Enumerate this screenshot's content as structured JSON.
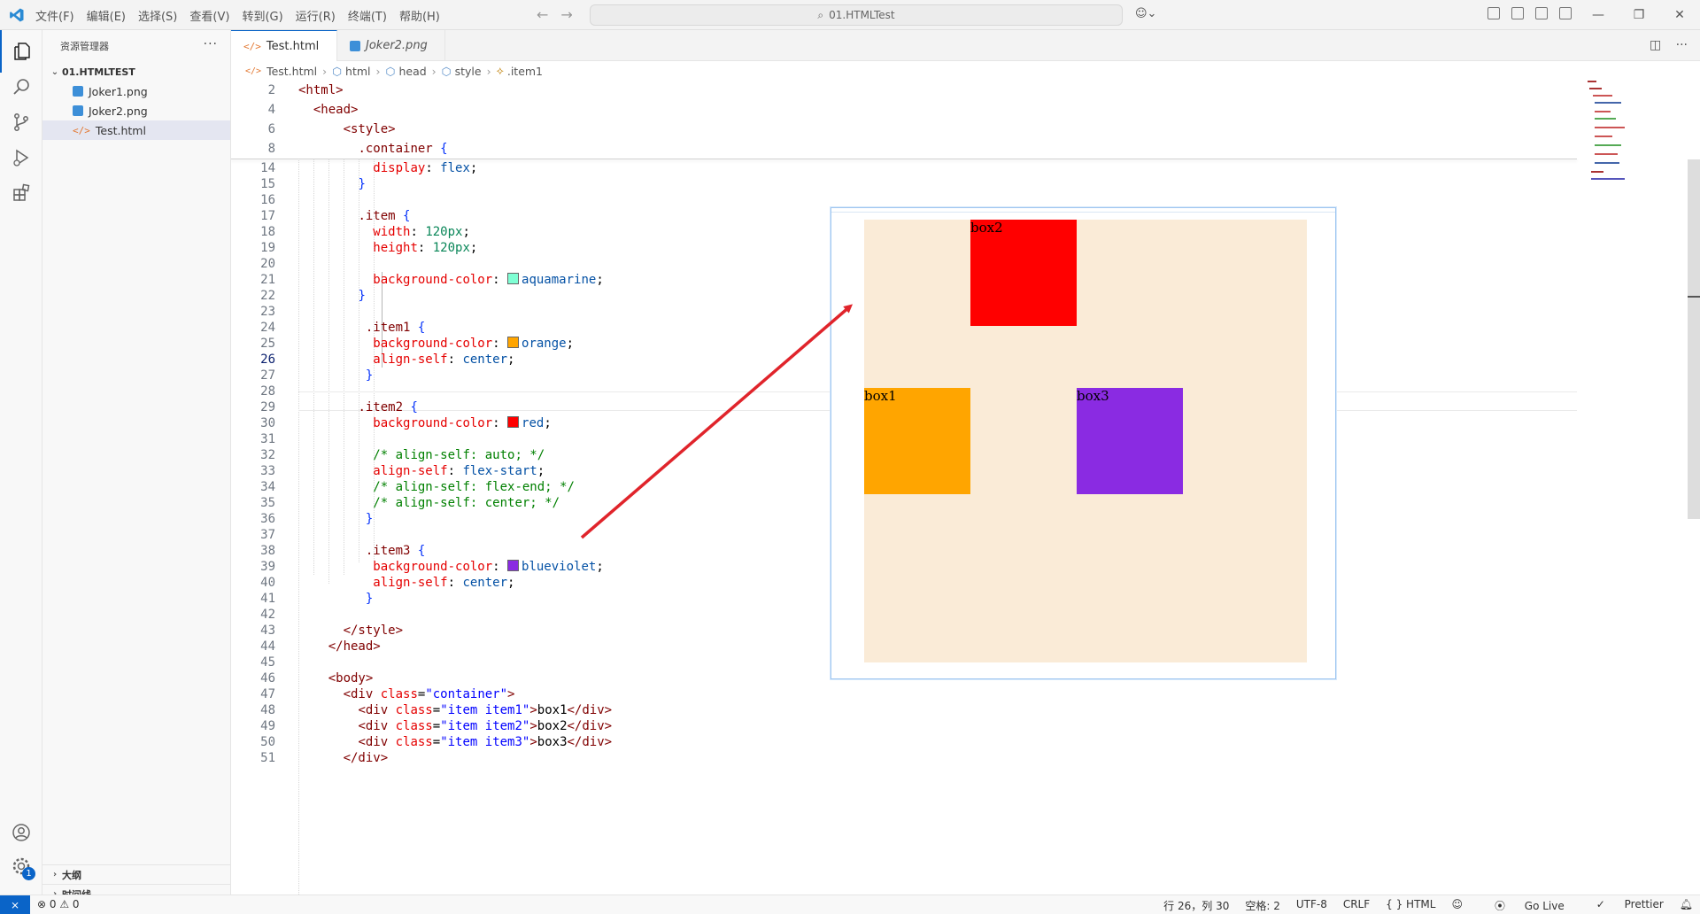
{
  "menu": [
    "文件(F)",
    "编辑(E)",
    "选择(S)",
    "查看(V)",
    "转到(G)",
    "运行(R)",
    "终端(T)",
    "帮助(H)"
  ],
  "search_text": "01.HTMLTest",
  "explorer": {
    "title": "资源管理器",
    "more": "···",
    "root": "01.HTMLTEST",
    "files": [
      "Joker1.png",
      "Joker2.png",
      "Test.html"
    ],
    "outline": "大纲",
    "timeline": "时间线"
  },
  "tabs": [
    {
      "label": "Test.html",
      "active": true
    },
    {
      "label": "Joker2.png",
      "active": false
    }
  ],
  "breadcrumb": [
    "Test.html",
    "html",
    "head",
    "style",
    ".item1"
  ],
  "accounts_badge": "1",
  "preview": {
    "box1": "box1",
    "box2": "box2",
    "box3": "box3"
  },
  "status": {
    "problems": "⊗ 0 ⚠ 0",
    "position": "行 26，列 30",
    "spaces": "空格: 2",
    "encoding": "UTF-8",
    "eol": "CRLF",
    "language": "{ } HTML",
    "golive": "Go Live",
    "prettier": "Prettier"
  },
  "colors": {
    "accent": "#0a64c8",
    "aquamarine": "#7fffd4",
    "orange": "#ffa500",
    "red": "#ff0000",
    "blueviolet": "#8a2be2",
    "antiquewhite": "#faebd7",
    "arrow": "#e0242b"
  }
}
